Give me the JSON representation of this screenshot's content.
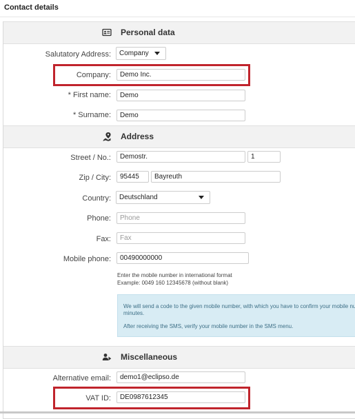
{
  "page": {
    "title": "Contact details"
  },
  "sections": {
    "personal": {
      "title": "Personal data",
      "icon": "id-card-icon"
    },
    "address": {
      "title": "Address",
      "icon": "map-marker-icon"
    },
    "misc": {
      "title": "Miscellaneous",
      "icon": "users-icon"
    }
  },
  "fields": {
    "salutation": {
      "label": "Salutatory Address:",
      "value": "Company"
    },
    "company": {
      "label": "Company:",
      "value": "Demo Inc."
    },
    "first_name": {
      "label": "* First name:",
      "value": "Demo"
    },
    "surname": {
      "label": "* Surname:",
      "value": "Demo"
    },
    "street": {
      "label": "Street / No.:",
      "value": "Demostr.",
      "number": "1"
    },
    "zip_city": {
      "label": "Zip / City:",
      "zip": "95445",
      "city": "Bayreuth"
    },
    "country": {
      "label": "Country:",
      "value": "Deutschland"
    },
    "phone": {
      "label": "Phone:",
      "placeholder": "Phone"
    },
    "fax": {
      "label": "Fax:",
      "placeholder": "Fax"
    },
    "mobile": {
      "label": "Mobile phone:",
      "value": "00490000000",
      "hint_line1": "Enter the mobile number in international format",
      "hint_line2": "Example: 0049 160 12345678 (without blank)"
    },
    "alt_email": {
      "label": "Alternative email:",
      "value": "demo1@eclipso.de"
    },
    "vat": {
      "label": "VAT ID:",
      "value": "DE0987612345"
    }
  },
  "info": {
    "line1": "We will send a code to the given mobile number, with which you have to confirm your mobile nu",
    "line2": "minutes.",
    "line3": "After receiving the SMS, verify your mobile number in the SMS menu."
  },
  "colors": {
    "highlight": "#c0242c",
    "info_bg": "#d8ecf4",
    "section_bg": "#f2f2f2"
  }
}
